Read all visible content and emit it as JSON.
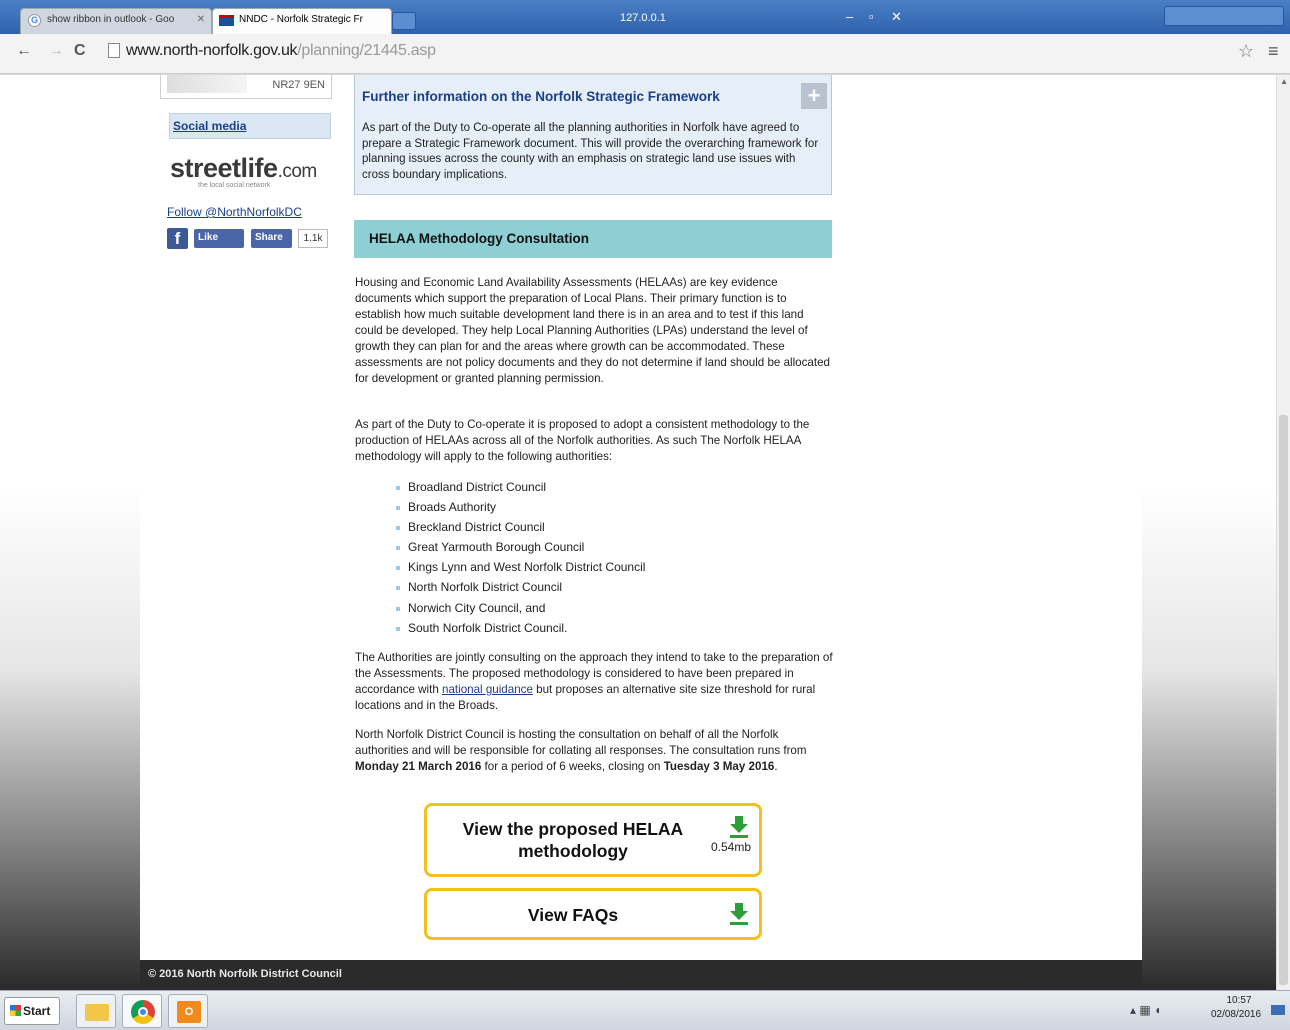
{
  "browser": {
    "tabs": [
      {
        "title": "show ribbon in outlook - Goo",
        "active": false
      },
      {
        "title": "NNDC - Norfolk Strategic Fr",
        "active": true
      }
    ],
    "window_title": "127.0.0.1",
    "url_domain": "www.north-norfolk.gov.uk",
    "url_path": "/planning/21445.asp",
    "icons": [
      "back-icon",
      "forward-icon",
      "reload-icon",
      "page-icon",
      "star-icon",
      "menu-icon"
    ]
  },
  "sidebar": {
    "postcode": "NR27 9EN",
    "social_media": "Social media",
    "streetlife": {
      "bold": "streetlife",
      "suffix": ".com",
      "tagline": "the local social network"
    },
    "follow": "Follow @NorthNorfolkDC",
    "facebook": {
      "like": "Like",
      "share": "Share",
      "count": "1.1k"
    }
  },
  "main": {
    "info_box": {
      "title": "Further information on the Norfolk Strategic Framework",
      "text": "As part of the Duty to Co-operate all the planning authorities in Norfolk have agreed to prepare a Strategic Framework document. This will provide the overarching framework for planning issues across the county with an emphasis on strategic land use issues with cross boundary implications."
    },
    "section_title": "HELAA Methodology Consultation",
    "p1": "Housing and Economic Land Availability Assessments (HELAAs) are key evidence documents which support the preparation of Local Plans. Their primary function is to establish how much suitable development land there is in an area and to test if this land could be developed. They help Local Planning Authorities (LPAs) understand the level of growth they can plan for and the areas where growth can be accommodated. These assessments are not policy documents and they do not determine if land should be allocated for development or granted planning permission.",
    "p2": "As part of the Duty to Co-operate it is proposed to adopt a consistent methodology to the production of HELAAs across all of the Norfolk authorities. As such The Norfolk HELAA methodology will apply to the following authorities:",
    "authorities": [
      "Broadland District Council",
      "Broads Authority",
      "Breckland District Council",
      "Great Yarmouth Borough Council",
      "Kings Lynn and West Norfolk District Council",
      "North Norfolk District Council",
      "Norwich City Council, and",
      "South Norfolk District Council."
    ],
    "p3": {
      "before": "The Authorities are jointly consulting on the approach they intend to take to the preparation of the Assessments. The proposed methodology is considered to have been prepared in accordance with ",
      "link": "national guidance",
      "after": " but proposes an alternative site size threshold for rural locations and in the Broads."
    },
    "p4": {
      "before": "North Norfolk District Council is hosting the consultation on behalf of all the Norfolk authorities and will be responsible for collating all responses. The consultation runs from ",
      "date1": "Monday 21 March 2016",
      "middle": " for a period of 6 weeks, closing on ",
      "date2": "Tuesday 3 May 2016",
      "after": "."
    },
    "buttons": {
      "helaa_line1": "View the proposed HELAA",
      "helaa_line2": "methodology",
      "helaa_size": "0.54mb",
      "faqs": "View FAQs"
    },
    "footer": "© 2016 North Norfolk District Council"
  },
  "taskbar": {
    "start": "Start",
    "time": "10:57",
    "date": "02/08/2016"
  },
  "colors": {
    "link": "#1a3f8a",
    "info_box_bg": "#e6eef7",
    "section_header_bg": "#8ecfd4",
    "button_border": "#f2c21b",
    "download_icon": "#2e9e3a",
    "footer_bg": "#2b2b2b"
  }
}
